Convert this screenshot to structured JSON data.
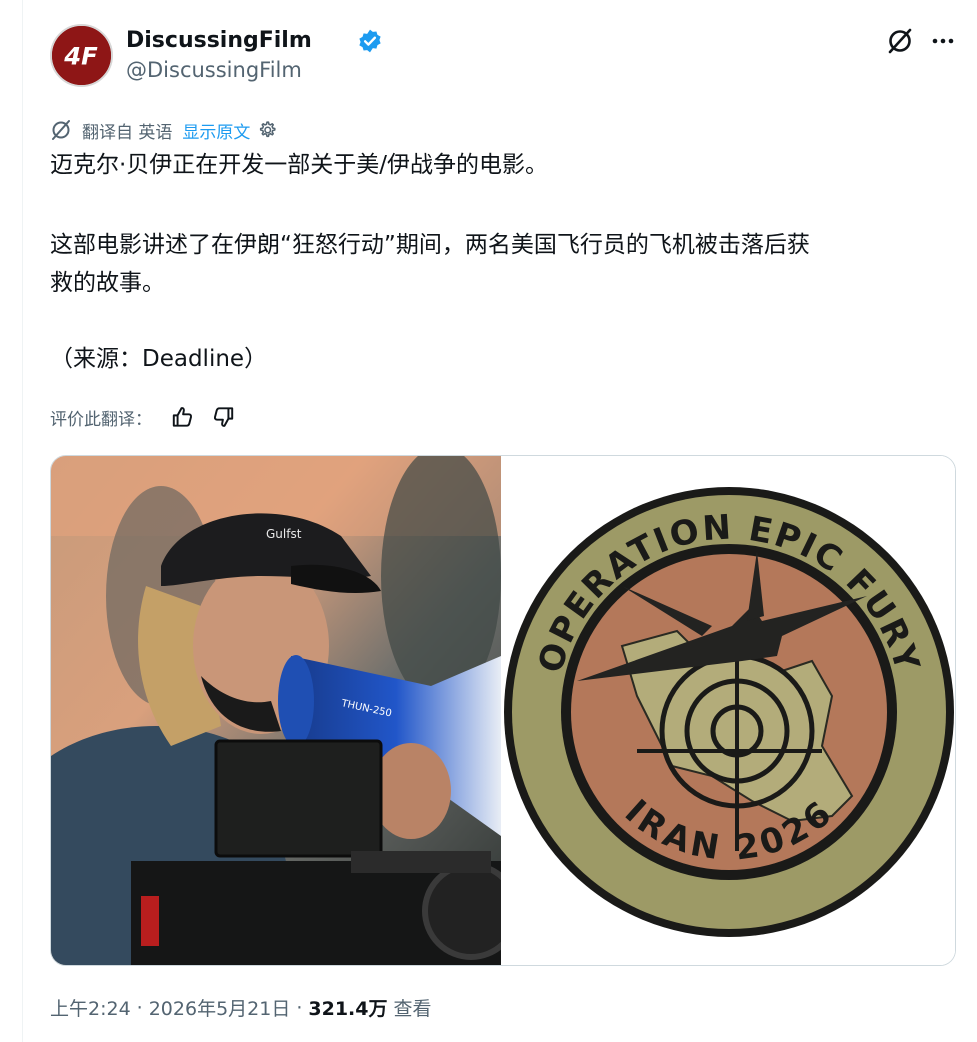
{
  "author": {
    "name": "DiscussingFilm",
    "handle": "@DiscussingFilm",
    "avatar_text": "4F",
    "verified_icon": "verified-badge-icon",
    "brand_color": "#1d9bf0"
  },
  "actions": {
    "grok_icon": "grok-icon",
    "more_icon": "more-icon"
  },
  "translate": {
    "label": "翻译自 英语",
    "show_original": "显示原文",
    "icon": "translate-icon",
    "settings_icon": "gear-icon"
  },
  "post": {
    "line1": "迈克尔·贝伊正在开发一部关于美/伊战争的电影。",
    "line2": "这部电影讲述了在伊朗“狂怒行动”期间，两名美国飞行员的飞机被击落后获",
    "line3": "救的故事。",
    "line4": "（来源：Deadline）"
  },
  "rate": {
    "label": "评价此翻译：",
    "like_icon": "thumbs-up-icon",
    "dislike_icon": "thumbs-down-icon"
  },
  "media": {
    "photo_left": "director-with-megaphone-photo",
    "cap_text": "Gulfst",
    "megaphone_text": "THUN-250",
    "patch_top_text": "OPERATION EPIC FURY",
    "patch_bottom_text": "IRAN 2026"
  },
  "footer": {
    "time": "上午2:24",
    "dot": "·",
    "date": "2026年5月21日",
    "views_count": "321.4万",
    "views_label": "查看"
  }
}
